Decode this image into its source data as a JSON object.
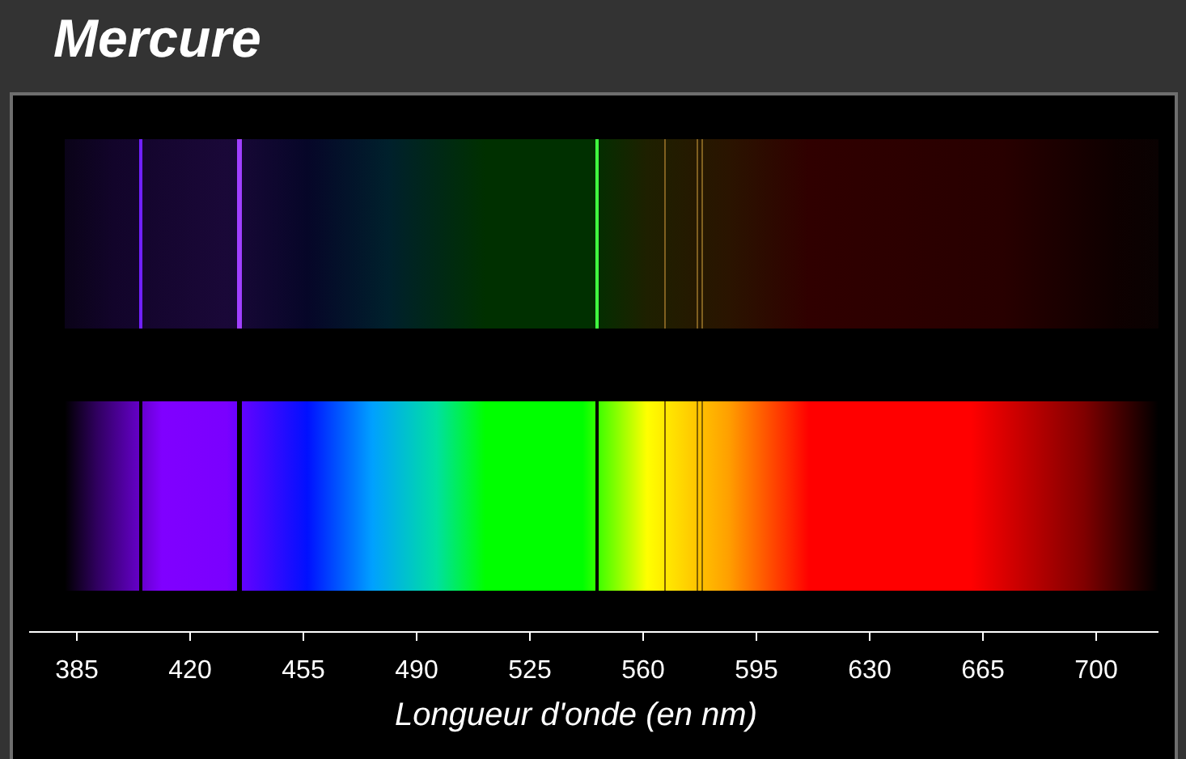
{
  "title": "Mercure",
  "spectra": [
    {
      "kind": "emission"
    },
    {
      "kind": "absorption"
    }
  ],
  "axis": {
    "ticks": [
      "385",
      "420",
      "455",
      "490",
      "525",
      "560",
      "595",
      "630",
      "665",
      "700"
    ],
    "label": "Longueur d'onde (en nm)"
  }
}
